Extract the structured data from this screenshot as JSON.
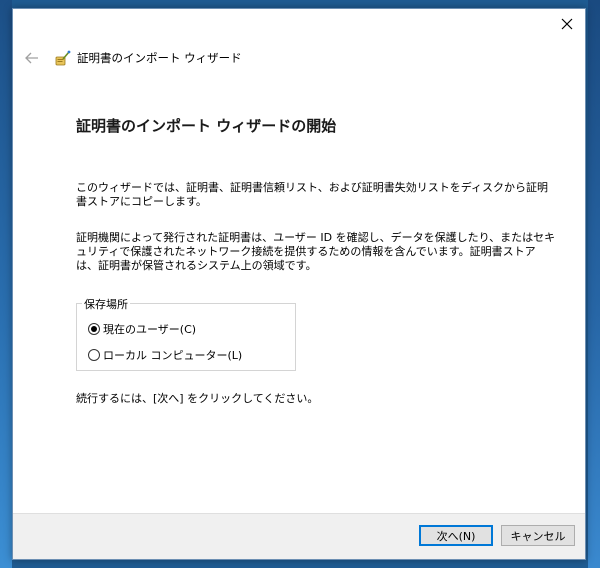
{
  "window": {
    "title": "証明書のインポート ウィザード"
  },
  "page": {
    "heading": "証明書のインポート ウィザードの開始",
    "description1": "このウィザードでは、証明書、証明書信頼リスト、および証明書失効リストをディスクから証明書ストアにコピーします。",
    "description2": "証明機関によって発行された証明書は、ユーザー ID を確認し、データを保護したり、またはセキュリティで保護されたネットワーク接続を提供するための情報を含んでいます。証明書ストアは、証明書が保管されるシステム上の領域です。",
    "instruction": "続行するには、[次へ] をクリックしてください。"
  },
  "store_location": {
    "label": "保存場所",
    "options": [
      {
        "label": "現在のユーザー(C)",
        "selected": true
      },
      {
        "label": "ローカル コンピューター(L)",
        "selected": false
      }
    ]
  },
  "buttons": {
    "next": "次へ(N)",
    "cancel": "キャンセル"
  },
  "colors": {
    "accent": "#0078d7",
    "footer_bg": "#f0f0f0"
  },
  "icons": {
    "close": "close-icon",
    "back": "back-arrow-icon",
    "wizard": "certificate-wizard-icon"
  }
}
